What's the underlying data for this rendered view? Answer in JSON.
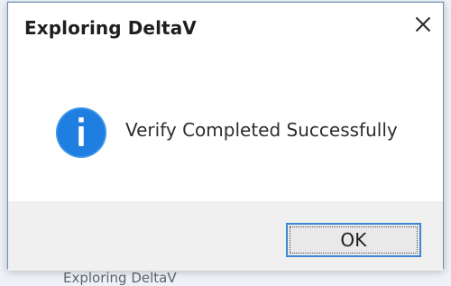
{
  "background": {
    "partial_text": "Exploring DeltaV"
  },
  "dialog": {
    "title": "Exploring DeltaV",
    "close_icon": "close-icon",
    "message_icon": "info-icon",
    "message": "Verify Completed Successfully",
    "ok_label": "OK"
  },
  "colors": {
    "accent": "#3c86d6",
    "info_blue": "#1f7fe0",
    "footer_bg": "#f0f0f0"
  }
}
